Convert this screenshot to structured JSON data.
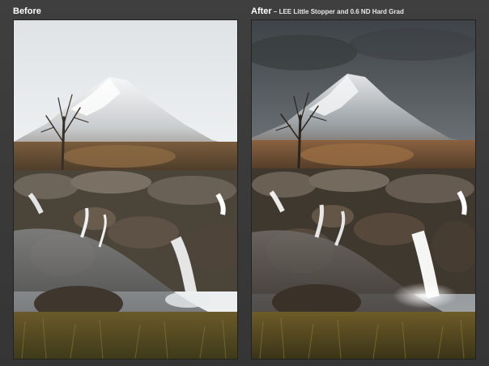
{
  "before": {
    "title": "Before"
  },
  "after": {
    "title": "After",
    "separator": " – ",
    "subtitle": "LEE Little Stopper and 0.6 ND Hard Grad"
  }
}
